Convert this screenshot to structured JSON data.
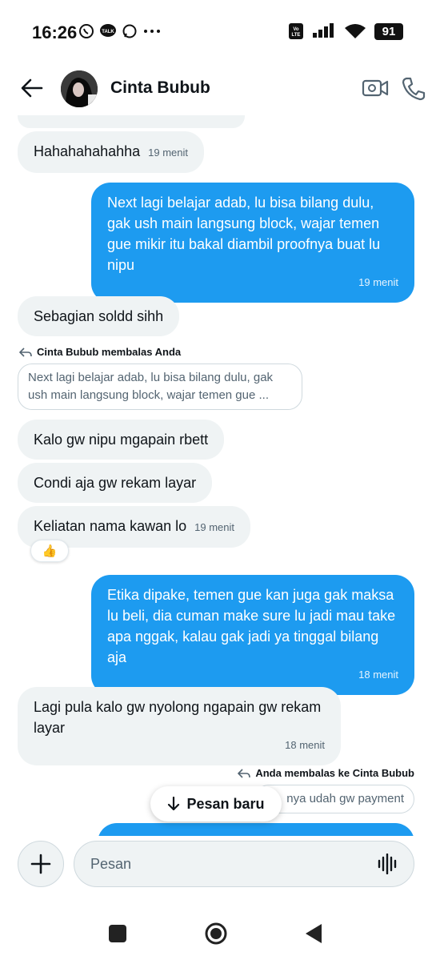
{
  "status_bar": {
    "time": "16:26",
    "battery": "91",
    "network_badge": "VoLTE"
  },
  "header": {
    "contact_name": "Cinta Bubub"
  },
  "messages": [
    {
      "text": "Hahahahahahha",
      "time": "19 menit"
    },
    {
      "text": "Next lagi belajar adab, lu bisa bilang dulu, gak ush main langsung block, wajar temen gue mikir itu bakal diambil proofnya buat lu nipu",
      "time": "19 menit"
    },
    {
      "text": "Sebagian soldd sihh"
    },
    {
      "reply_label_name": "Cinta Bubub",
      "reply_label_suffix": "membalas Anda",
      "quote": "Next lagi belajar adab, lu bisa bilang dulu, gak ush main langsung block, wajar temen gue ..."
    },
    {
      "text": "Kalo gw nipu mgapain rbett"
    },
    {
      "text": "Condi aja gw rekam layar"
    },
    {
      "text": "Keliatan nama kawan lo",
      "time": "19 menit",
      "reaction": "👍"
    },
    {
      "text": "Etika dipake, temen gue kan juga gak maksa lu beli, dia cuman make sure lu jadi mau take apa nggak, kalau gak jadi ya tinggal bilang aja",
      "time": "18 menit"
    },
    {
      "text": "Lagi pula kalo gw nyolong ngapain gw rekam layar",
      "time": "18 menit"
    },
    {
      "reply_label_prefix": "Anda membalas ke",
      "reply_label_name": "Cinta Bubub",
      "quote": "nya udah gw payment"
    }
  ],
  "new_message_pill": "Pesan baru",
  "composer": {
    "placeholder": "Pesan"
  },
  "colors": {
    "outgoing_bubble": "#1d9bf0",
    "incoming_bubble": "#eff3f4"
  }
}
